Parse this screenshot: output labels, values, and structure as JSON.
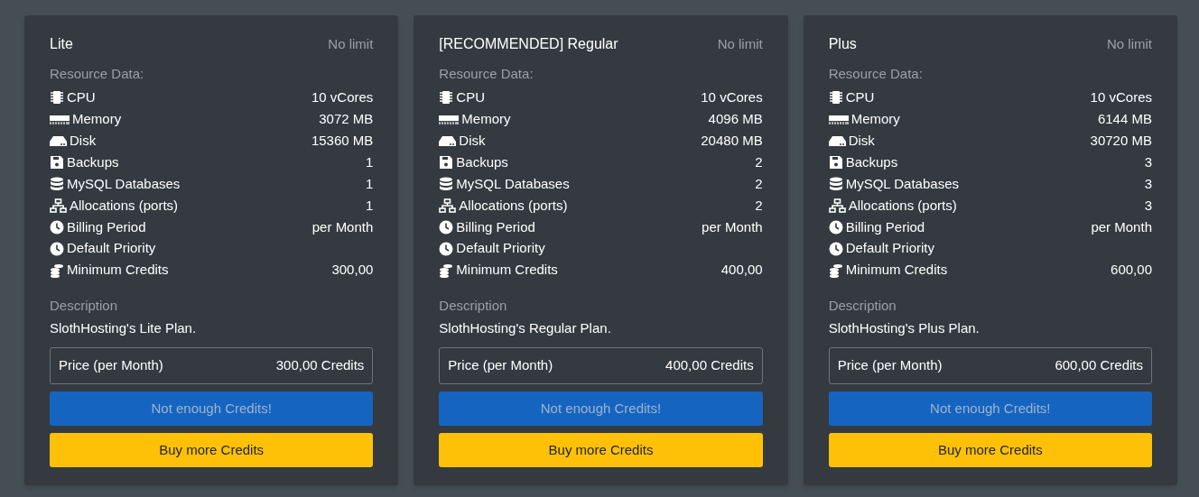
{
  "plans": [
    {
      "name": "Lite",
      "limit": "No limit",
      "resources_label": "Resource Data:",
      "resources": [
        {
          "kind": "cpu",
          "label": "CPU",
          "value": "10 vCores"
        },
        {
          "kind": "memory",
          "label": "Memory",
          "value": "3072 MB"
        },
        {
          "kind": "disk",
          "label": "Disk",
          "value": "15360 MB"
        },
        {
          "kind": "save",
          "label": "Backups",
          "value": "1"
        },
        {
          "kind": "database",
          "label": "MySQL Databases",
          "value": "1"
        },
        {
          "kind": "network",
          "label": "Allocations (ports)",
          "value": "1"
        },
        {
          "kind": "clock",
          "label": "Billing Period",
          "value": "per Month"
        },
        {
          "kind": "clock",
          "label": "Default Priority"
        },
        {
          "kind": "coins",
          "label": "Minimum Credits",
          "value": "300,00"
        }
      ],
      "description_label": "Description",
      "description": "SlothHosting's Lite Plan.",
      "price_label": "Price (per Month)",
      "price": "300,00 Credits",
      "order_button": {
        "label": "Not enough Credits!",
        "disabled": true
      },
      "buy_button": "Buy more Credits"
    },
    {
      "name": "[RECOMMENDED] Regular",
      "limit": "No limit",
      "resources_label": "Resource Data:",
      "resources": [
        {
          "kind": "cpu",
          "label": "CPU",
          "value": "10 vCores"
        },
        {
          "kind": "memory",
          "label": "Memory",
          "value": "4096 MB"
        },
        {
          "kind": "disk",
          "label": "Disk",
          "value": "20480 MB"
        },
        {
          "kind": "save",
          "label": "Backups",
          "value": "2"
        },
        {
          "kind": "database",
          "label": "MySQL Databases",
          "value": "2"
        },
        {
          "kind": "network",
          "label": "Allocations (ports)",
          "value": "2"
        },
        {
          "kind": "clock",
          "label": "Billing Period",
          "value": "per Month"
        },
        {
          "kind": "clock",
          "label": "Default Priority"
        },
        {
          "kind": "coins",
          "label": "Minimum Credits",
          "value": "400,00"
        }
      ],
      "description_label": "Description",
      "description": "SlothHosting's Regular Plan.",
      "price_label": "Price (per Month)",
      "price": "400,00 Credits",
      "order_button": {
        "label": "Not enough Credits!",
        "disabled": true
      },
      "buy_button": "Buy more Credits"
    },
    {
      "name": "Plus",
      "limit": "No limit",
      "resources_label": "Resource Data:",
      "resources": [
        {
          "kind": "cpu",
          "label": "CPU",
          "value": "10 vCores"
        },
        {
          "kind": "memory",
          "label": "Memory",
          "value": "6144 MB"
        },
        {
          "kind": "disk",
          "label": "Disk",
          "value": "30720 MB"
        },
        {
          "kind": "save",
          "label": "Backups",
          "value": "3"
        },
        {
          "kind": "database",
          "label": "MySQL Databases",
          "value": "3"
        },
        {
          "kind": "network",
          "label": "Allocations (ports)",
          "value": "3"
        },
        {
          "kind": "clock",
          "label": "Billing Period",
          "value": "per Month"
        },
        {
          "kind": "clock",
          "label": "Default Priority"
        },
        {
          "kind": "coins",
          "label": "Minimum Credits",
          "value": "600,00"
        }
      ],
      "description_label": "Description",
      "description": "SlothHosting's Plus Plan.",
      "price_label": "Price (per Month)",
      "price": "600,00 Credits",
      "order_button": {
        "label": "Not enough Credits!",
        "disabled": true
      },
      "buy_button": "Buy more Credits"
    }
  ]
}
